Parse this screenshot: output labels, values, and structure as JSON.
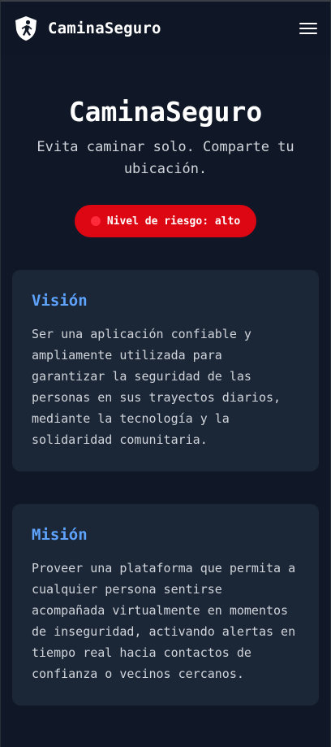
{
  "header": {
    "brand": "CaminaSeguro",
    "logo_icon": "walking-person-shield-icon",
    "menu_icon": "hamburger-menu-icon"
  },
  "hero": {
    "title": "CaminaSeguro",
    "subtitle": "Evita caminar solo. Comparte tu ubicación."
  },
  "risk_badge": {
    "label": "Nivel de riesgo: alto",
    "color": "#dc0712"
  },
  "vision": {
    "title": "Visión",
    "text": "Ser una aplicación confiable y ampliamente utilizada para garantizar la seguridad de las personas en sus trayectos diarios, mediante la tecnología y la solidaridad comunitaria."
  },
  "mission": {
    "title": "Misión",
    "text": "Proveer una plataforma que permita a cualquier persona sentirse acompañada virtualmente en momentos de inseguridad, activando alertas en tiempo real hacia contactos de confianza o vecinos cercanos."
  },
  "colors": {
    "background": "#101827",
    "card": "#1b2637",
    "accent": "#5ea4ff"
  }
}
